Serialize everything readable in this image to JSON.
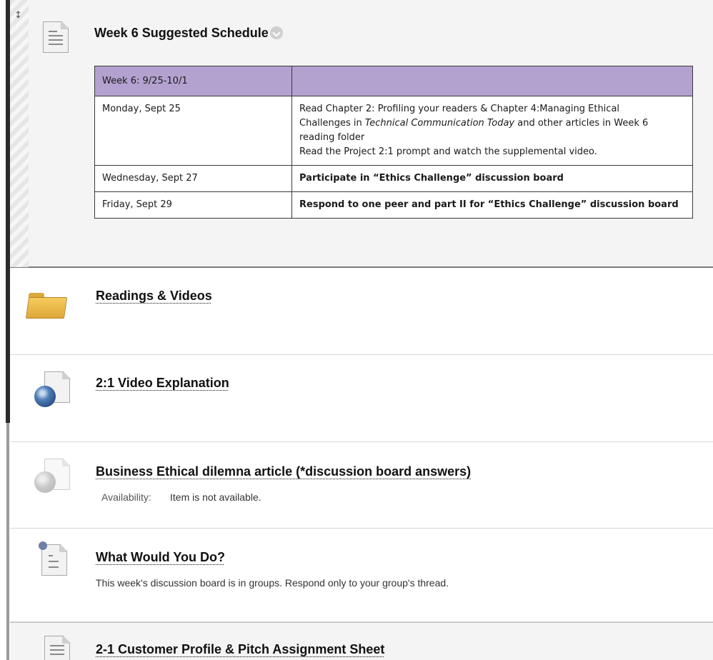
{
  "items": [
    {
      "title": "Week 6 Suggested Schedule",
      "table": {
        "header": [
          "Week 6: 9/25-10/1",
          ""
        ],
        "rows": [
          {
            "day": "Monday, Sept 25",
            "line1a": "Read Chapter 2: Profiling your readers & Chapter 4:Managing Ethical",
            "line2a": "Challenges in ",
            "line2i": "Technical Communication Today",
            "line2b": " and other articles in Week 6",
            "line3": "reading folder",
            "line4": "Read the Project 2:1 prompt and watch the supplemental video."
          },
          {
            "day": "Wednesday, Sept 27",
            "text": "Participate in “Ethics Challenge” discussion board"
          },
          {
            "day": "Friday, Sept 29",
            "text": "Respond to one peer and part II  for “Ethics Challenge” discussion board"
          }
        ]
      }
    },
    {
      "title": "Readings & Videos"
    },
    {
      "title": "2:1 Video Explanation"
    },
    {
      "title": "Business Ethical dilemna article (*discussion board answers)",
      "availability_label": "Availability:",
      "availability_value": "Item is not available."
    },
    {
      "title": "What Would You Do?",
      "description": "This week's discussion board is in groups. Respond only to your group's thread."
    },
    {
      "title": "2-1 Customer Profile & Pitch Assignment Sheet"
    }
  ],
  "icons": {
    "drag_handle": "drag-handle-icon",
    "document": "document-icon",
    "status": "checkmark-status-icon",
    "folder": "folder-icon",
    "web_link": "globe-link-icon",
    "discussion": "discussion-board-icon"
  },
  "colors": {
    "table_header": "#b3a2cf",
    "folder": "#f5cc5c",
    "globe": "#4f7fb8"
  }
}
